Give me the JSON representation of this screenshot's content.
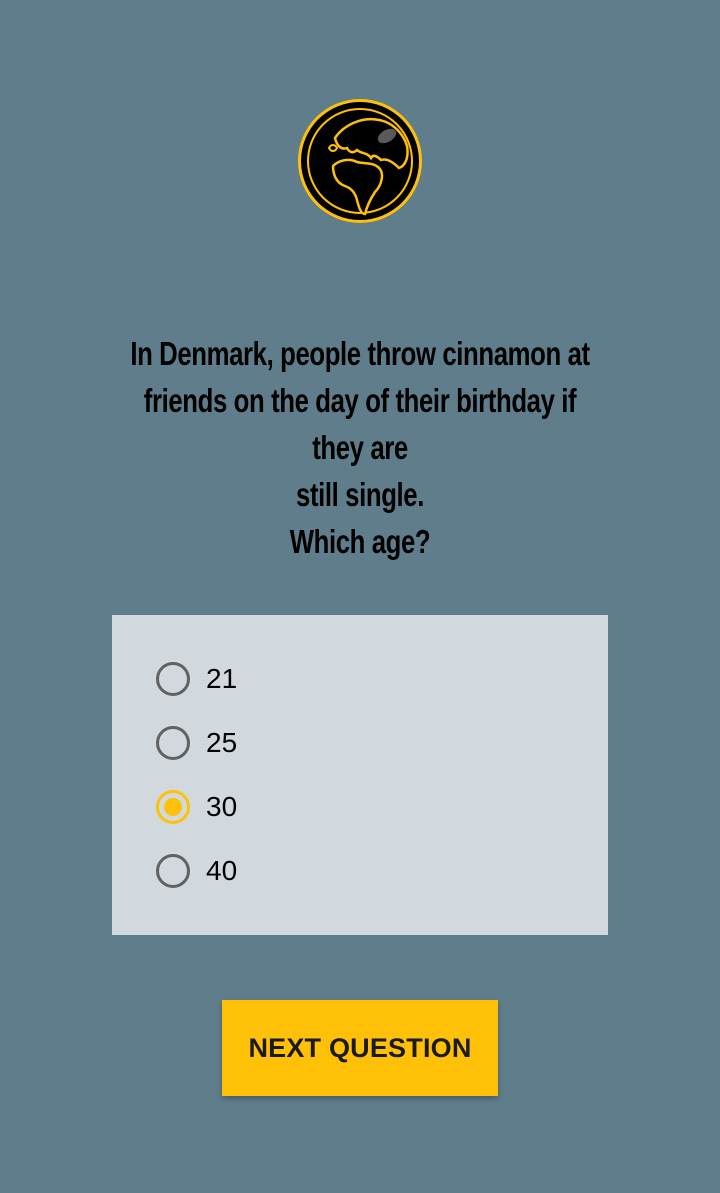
{
  "question": {
    "lines": [
      "In Denmark, people throw cinnamon at",
      "friends on the day of their birthday if they are",
      "still single.",
      "Which age?"
    ]
  },
  "options": [
    {
      "label": "21",
      "selected": false
    },
    {
      "label": "25",
      "selected": false
    },
    {
      "label": "30",
      "selected": true
    },
    {
      "label": "40",
      "selected": false
    }
  ],
  "next_button": {
    "label": "NEXT QUESTION"
  },
  "colors": {
    "background": "#607d8b",
    "card": "#d1d9df",
    "accent": "#ffc107"
  },
  "icons": {
    "logo": "globe-icon"
  }
}
